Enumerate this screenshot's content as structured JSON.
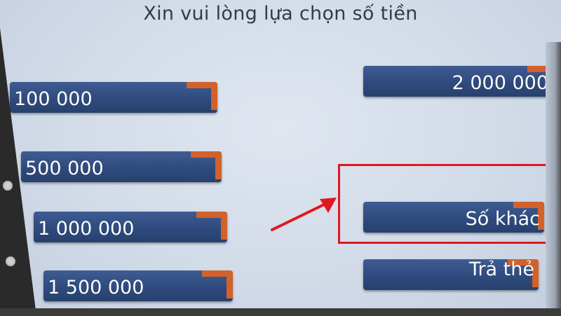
{
  "screen": {
    "title": "Xin vui lòng lựa chọn số tiền"
  },
  "amounts_left": [
    {
      "label": "100 000"
    },
    {
      "label": "500 000"
    },
    {
      "label": "1 000 000"
    },
    {
      "label": "1 500 000"
    }
  ],
  "options_right": [
    {
      "label": "2 000 000"
    },
    {
      "label": "Số khác"
    },
    {
      "label": "Trả thẻ"
    }
  ],
  "colors": {
    "button_blue": "#2f4b7e",
    "button_accent": "#d2612a",
    "highlight": "#e0171e",
    "screen_bg": "#d2dbe8"
  }
}
